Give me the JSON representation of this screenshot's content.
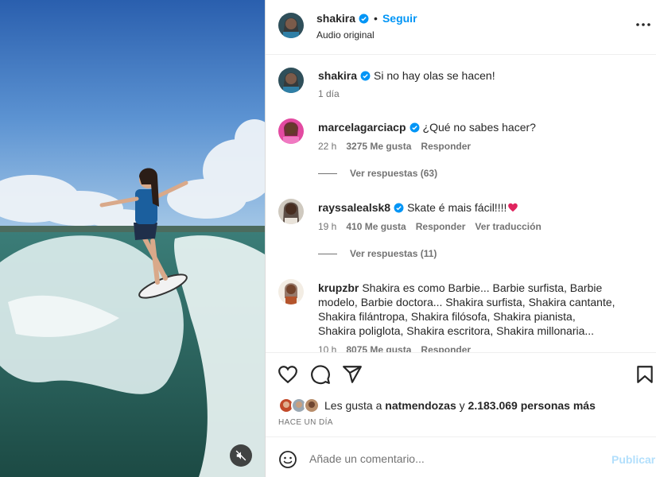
{
  "post": {
    "author": "shakira",
    "follow_label": "Seguir",
    "separator": "•",
    "audio": "Audio original",
    "caption": "Si no hay olas se hacen!",
    "caption_age": "1 día"
  },
  "comments": [
    {
      "user": "marcelagarciacp",
      "verified": true,
      "text": "¿Qué no sabes hacer?",
      "age": "22 h",
      "likes": "3275 Me gusta",
      "reply_label": "Responder",
      "replies": "Ver respuestas (63)"
    },
    {
      "user": "rayssalealsk8",
      "verified": true,
      "text": "Skate é mais fácil!!!!",
      "emoji": "heart-emoji",
      "age": "19 h",
      "likes": "410 Me gusta",
      "reply_label": "Responder",
      "translate_label": "Ver traducción",
      "replies": "Ver respuestas (11)"
    },
    {
      "user": "krupzbr",
      "verified": false,
      "text": "Shakira es como Barbie... Barbie surfista, Barbie modelo, Barbie doctora... Shakira surfista, Shakira cantante, Shakira filántropa, Shakira filósofa, Shakira pianista, Shakira poliglota, Shakira escritora, Shakira millonaria...",
      "age": "10 h",
      "likes": "8075 Me gusta",
      "reply_label": "Responder"
    }
  ],
  "likes": {
    "prefix": "Les gusta a",
    "first_user": "natmendozas",
    "connector": "y",
    "others": "2.183.069 personas más"
  },
  "date_label": "HACE UN DÍA",
  "add_comment": {
    "placeholder": "Añade un comentario...",
    "publish_label": "Publicar"
  },
  "icons": {
    "verified": "verified-badge-icon",
    "more": "more-options-icon",
    "like": "heart-icon",
    "comment": "comment-icon",
    "share": "send-icon",
    "save": "bookmark-icon",
    "emoji": "emoji-icon",
    "mute": "muted-speaker-icon"
  },
  "colors": {
    "accent": "#0095f6",
    "verified": "#0095f6",
    "publish_disabled": "#b2dffc",
    "text": "#262626",
    "muted": "#737373"
  }
}
